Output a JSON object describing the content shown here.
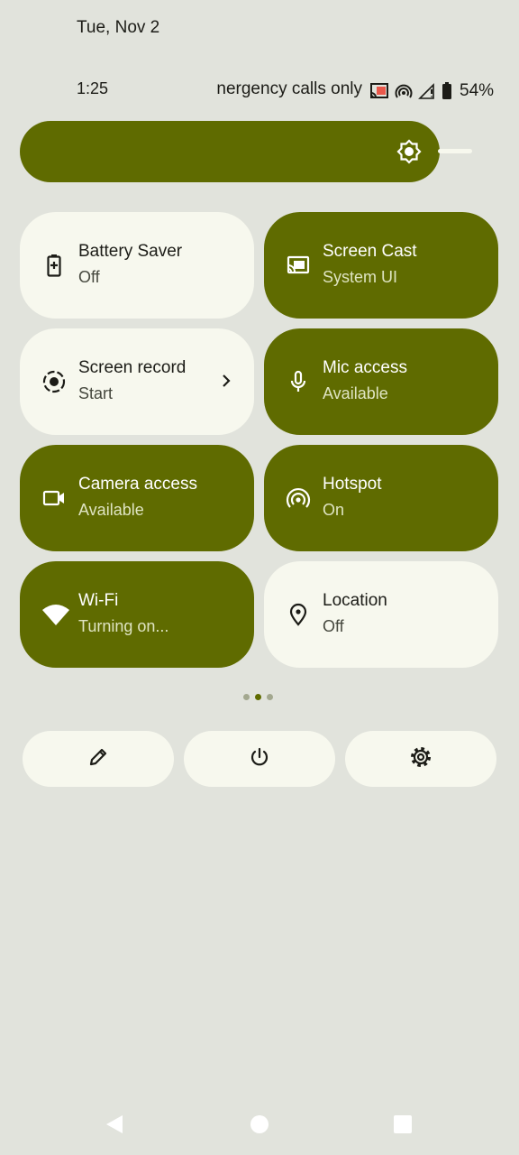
{
  "header": {
    "date": "Tue, Nov 2",
    "time": "1:25",
    "carrier_text": "nergency calls only",
    "battery_percent": "54%"
  },
  "status_icons": [
    "cast-icon",
    "hotspot-icon",
    "signal-icon",
    "battery-icon"
  ],
  "brightness": {
    "icon": "brightness-icon",
    "level": 0.92
  },
  "tiles": [
    {
      "label": "Battery Saver",
      "state": "Off",
      "icon": "battery-saver-icon",
      "active": false
    },
    {
      "label": "Screen Cast",
      "state": "System UI",
      "icon": "screen-cast-icon",
      "active": true
    },
    {
      "label": "Screen record",
      "state": "Start",
      "icon": "screen-record-icon",
      "active": false
    },
    {
      "label": "Mic access",
      "state": "Available",
      "icon": "mic-icon",
      "active": true
    },
    {
      "label": "Camera access",
      "state": "Available",
      "icon": "camera-icon",
      "active": true
    },
    {
      "label": "Hotspot",
      "state": "On",
      "icon": "hotspot-icon",
      "active": true
    },
    {
      "label": "Wi-Fi",
      "state": "Turning on...",
      "icon": "wifi-icon",
      "active": true
    },
    {
      "label": "Location",
      "state": "Off",
      "icon": "location-icon",
      "active": false
    }
  ],
  "pager": {
    "pages": 3,
    "current": 2
  },
  "bottom_buttons": [
    "edit-icon",
    "power-icon",
    "settings-icon"
  ],
  "colors": {
    "background": "#e1e3dc",
    "accent": "#5f6b00",
    "tile_light": "#f7f8ee"
  }
}
